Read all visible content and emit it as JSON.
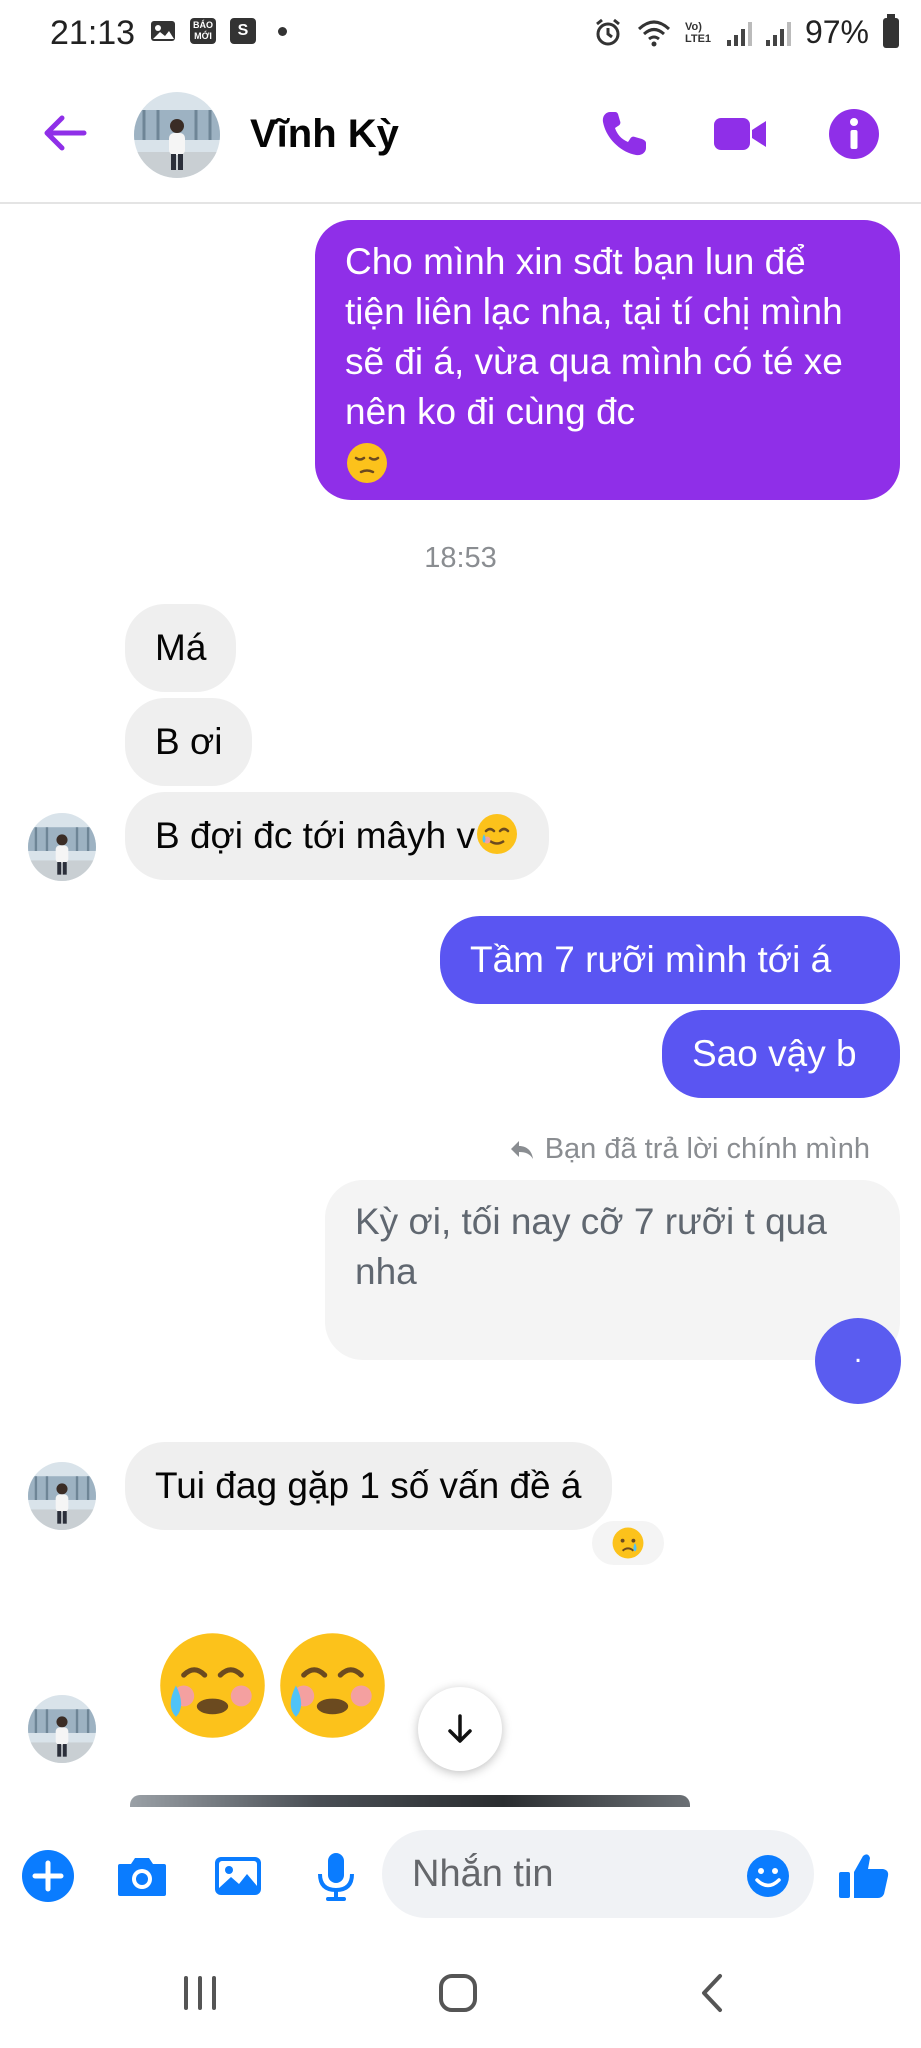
{
  "status_bar": {
    "time": "21:13",
    "news_badge": "BÁO MỚI",
    "shop_badge": "S",
    "network": "Vo) LTE1",
    "battery": "97%"
  },
  "header": {
    "contact_name": "Vĩnh Kỳ"
  },
  "messages": {
    "out_1": "Cho mình xin sđt bạn lun để tiện liên lạc nha, tại tí chị mình sẽ đi á, vừa qua mình có té xe nên ko đi cùng đc",
    "timestamp": "18:53",
    "in_1": "Má",
    "in_2": "B ơi",
    "in_3": "B đợi đc tới mâyh v",
    "out_2": "Tầm 7 rưỡi mình tới á",
    "out_3": "Sao vậy b",
    "reply_note": "Bạn đã trả lời chính mình",
    "reply_quote": "Kỳ ơi, tối nay cỡ 7 rưỡi t qua nha",
    "seen_marker": ".",
    "in_4": "Tui đag gặp 1 số vấn đề á"
  },
  "composer": {
    "placeholder": "Nhắn tin"
  },
  "colors": {
    "accent": "#8f2fe8",
    "bubble_blue": "#5a55f2",
    "composer_blue": "#0a7cff"
  }
}
